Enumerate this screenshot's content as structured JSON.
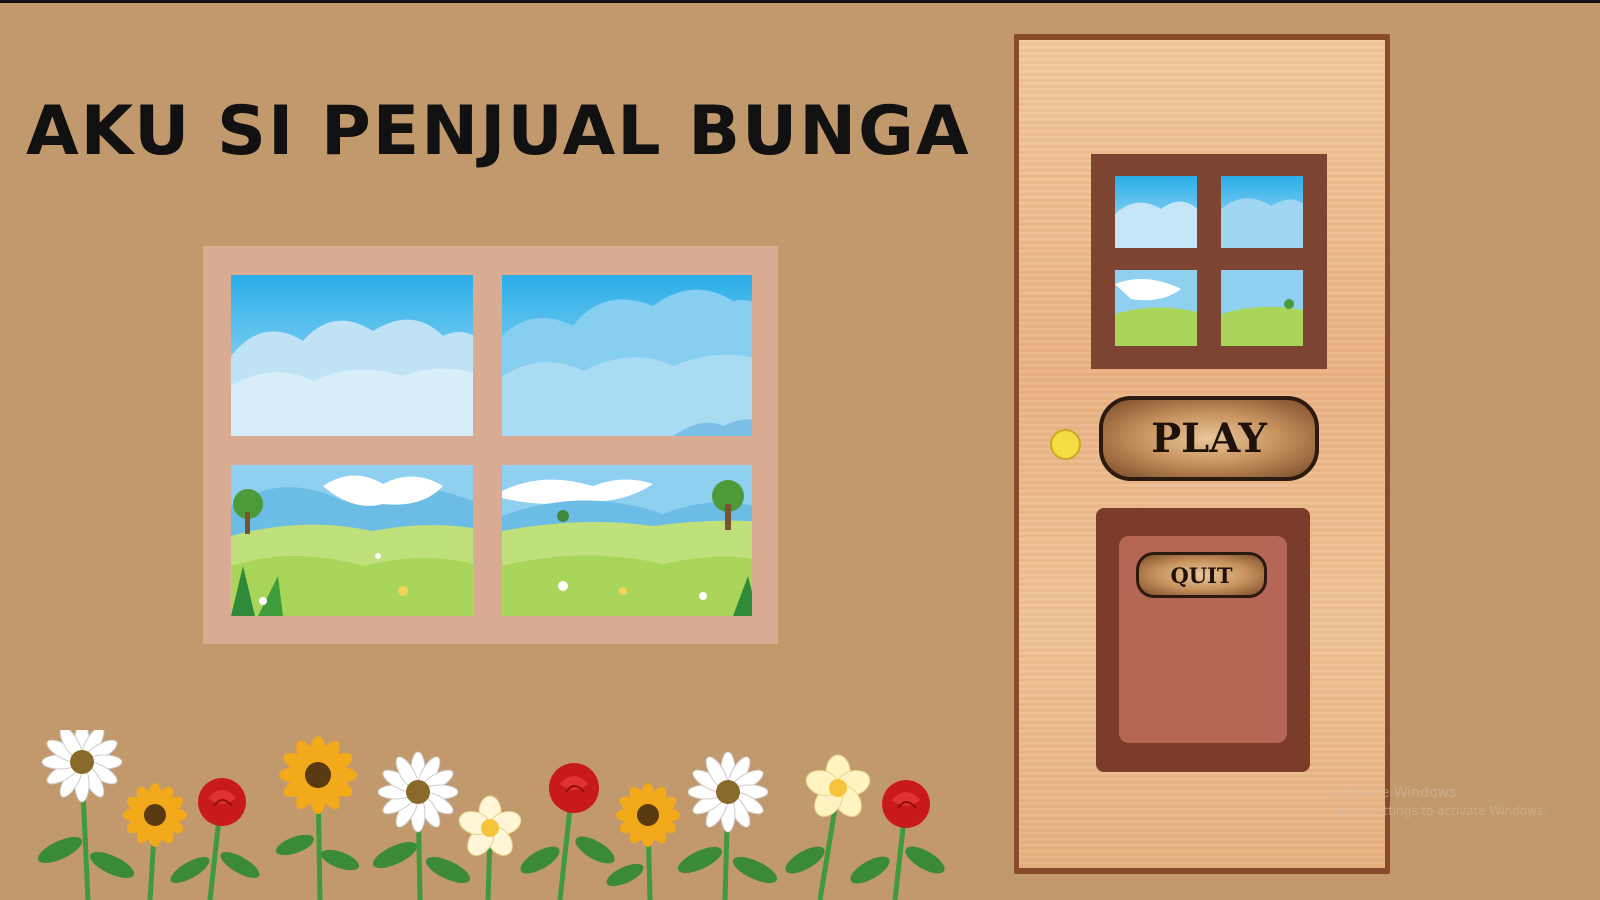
{
  "title": "AKU SI PENJUAL BUNGA",
  "buttons": {
    "play_label": "PLAY",
    "quit_label": "QUIT"
  },
  "watermark": {
    "line1": "Activate Windows",
    "line2": "Go to Settings to activate Windows."
  },
  "colors": {
    "wall": "#c2996c",
    "window_frame": "#d8ab92",
    "door_frame": "#8a4a2c",
    "door_wood": "#eab384",
    "knob": "#f4dc44",
    "panel": "#b66655",
    "sky": "#2fb0ea",
    "grass": "#a9d65a"
  },
  "flowers": [
    "daisy",
    "sunflower",
    "rose",
    "sunflower",
    "daisy",
    "frangipani",
    "rose",
    "sunflower",
    "daisy",
    "frangipani",
    "rose"
  ]
}
